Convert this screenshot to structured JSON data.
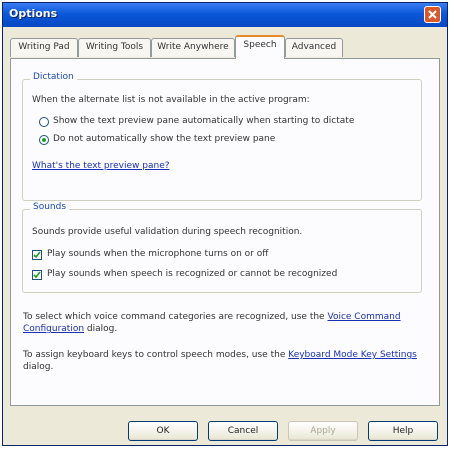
{
  "window": {
    "title": "Options"
  },
  "tabs": [
    {
      "label": "Writing Pad"
    },
    {
      "label": "Writing Tools"
    },
    {
      "label": "Write Anywhere"
    },
    {
      "label": "Speech"
    },
    {
      "label": "Advanced"
    }
  ],
  "dictation": {
    "title": "Dictation",
    "intro": "When the alternate list is not available in the active program:",
    "options": [
      {
        "label": "Show the text preview pane automatically when starting to dictate",
        "selected": false
      },
      {
        "label": "Do not automatically show the text preview pane",
        "selected": true
      }
    ],
    "link": "What's the text preview pane?"
  },
  "sounds": {
    "title": "Sounds",
    "intro": "Sounds provide useful validation during speech recognition.",
    "checks": [
      {
        "label": "Play sounds when the microphone turns on or off",
        "checked": true
      },
      {
        "label": "Play sounds when speech is recognized or cannot be recognized",
        "checked": true
      }
    ]
  },
  "info1": {
    "prefix": "To select which voice command categories are recognized, use the",
    "link": "Voice Command Configuration",
    "suffix": "dialog."
  },
  "info2": {
    "prefix": "To assign keyboard keys to control speech modes, use the",
    "link": "Keyboard Mode Key Settings",
    "suffix": "dialog."
  },
  "buttons": {
    "ok": "OK",
    "cancel": "Cancel",
    "apply": "Apply",
    "help": "Help"
  },
  "colors": {
    "titlebar": "#0a58d8",
    "active_tab_accent": "#e68b2c",
    "link": "#1a2fb3",
    "group_title": "#1a49b5"
  }
}
